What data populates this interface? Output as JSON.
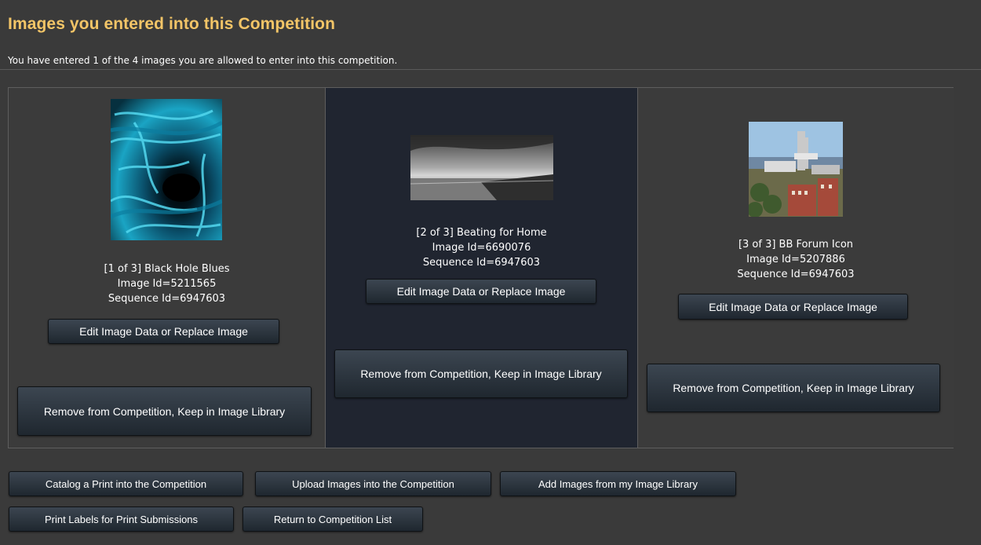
{
  "header": {
    "title": "Images you entered into this Competition",
    "entry_info": "You have entered 1 of the 4 images you are allowed to enter into this competition."
  },
  "entries": [
    {
      "index_label": "[1 of 3] Black Hole Blues",
      "image_id": "Image Id=5211565",
      "sequence_id": "Sequence Id=6947603",
      "edit_label": "Edit Image Data or Replace Image",
      "remove_label": "Remove from Competition, Keep in Image Library",
      "thumbnail_icon": "abstract-blue-swirl-image"
    },
    {
      "index_label": "[2 of 3] Beating for Home",
      "image_id": "Image Id=6690076",
      "sequence_id": "Sequence Id=6947603",
      "edit_label": "Edit Image Data or Replace Image",
      "remove_label": "Remove from Competition, Keep in Image Library",
      "thumbnail_icon": "monochrome-sea-landscape-image"
    },
    {
      "index_label": "[3 of 3] BB Forum Icon",
      "image_id": "Image Id=5207886",
      "sequence_id": "Sequence Id=6947603",
      "edit_label": "Edit Image Data or Replace Image",
      "remove_label": "Remove from Competition, Keep in Image Library",
      "thumbnail_icon": "city-tower-photo-image"
    }
  ],
  "footer": {
    "catalog_print": "Catalog a Print into the Competition",
    "upload_images": "Upload Images into the Competition",
    "add_from_library": "Add Images from my Image Library",
    "print_labels": "Print Labels for Print Submissions",
    "return_list": "Return to Competition List"
  },
  "colors": {
    "title": "#f3c567",
    "page_bg": "#3a3a3a",
    "highlight_cell_bg": "#202530",
    "button_bg": "#2b333c"
  }
}
